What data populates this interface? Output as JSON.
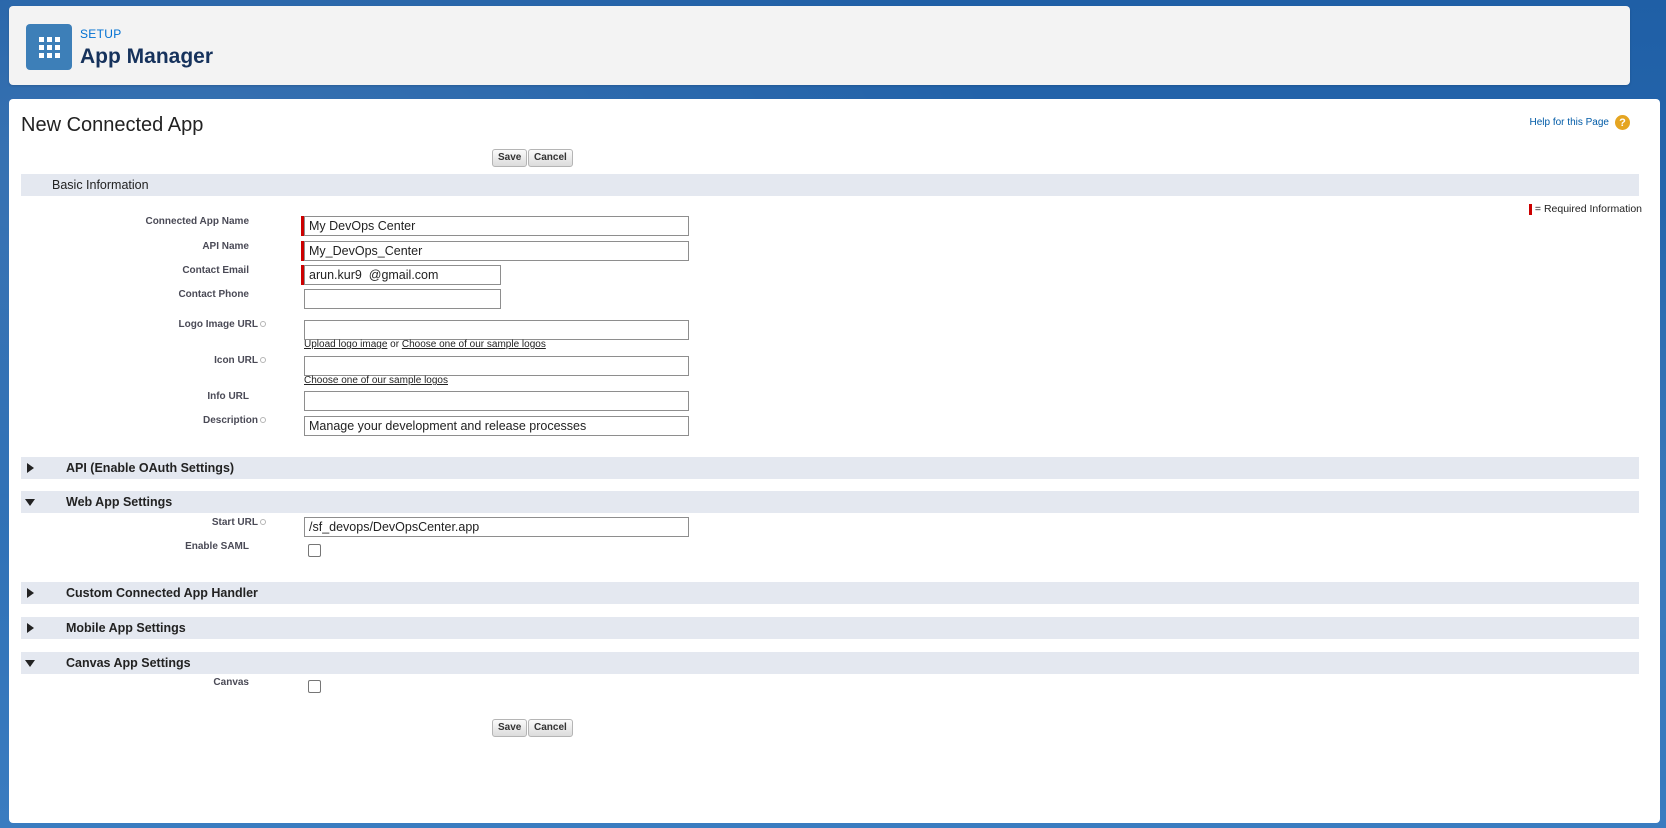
{
  "header": {
    "setup_label": "SETUP",
    "page_name": "App Manager",
    "icon": "app-launcher-grid-icon"
  },
  "page": {
    "title": "New Connected App",
    "help_link": "Help for this Page",
    "help_icon": "?"
  },
  "buttons": {
    "save": "Save",
    "cancel": "Cancel"
  },
  "required_info": "= Required Information",
  "sections": {
    "basic": "Basic Information",
    "api": "API (Enable OAuth Settings)",
    "web": "Web App Settings",
    "custom": "Custom Connected App Handler",
    "mobile": "Mobile App Settings",
    "canvas": "Canvas App Settings"
  },
  "fields": {
    "app_name": {
      "label": "Connected App Name",
      "value": "My DevOps Center"
    },
    "api_name": {
      "label": "API Name",
      "value": "My_DevOps_Center"
    },
    "contact_email": {
      "label": "Contact Email",
      "value": "arun.kur9  @gmail.com"
    },
    "contact_phone": {
      "label": "Contact Phone",
      "value": ""
    },
    "logo_url": {
      "label": "Logo Image URL",
      "value": ""
    },
    "icon_url": {
      "label": "Icon URL",
      "value": ""
    },
    "info_url": {
      "label": "Info URL",
      "value": ""
    },
    "description": {
      "label": "Description",
      "value": "Manage your development and release processes"
    },
    "start_url": {
      "label": "Start URL",
      "value": "/sf_devops/DevOpsCenter.app"
    },
    "enable_saml": {
      "label": "Enable SAML"
    },
    "canvas": {
      "label": "Canvas"
    }
  },
  "links": {
    "upload_logo": "Upload logo image",
    "or": " or ",
    "choose_logo": "Choose one of our sample logos",
    "choose_icon": "Choose one of our sample logos"
  },
  "colors": {
    "header_bg": "#f3f3f3",
    "section_bg": "#e4e8f0",
    "required": "#cc0000",
    "link": "#015ba7"
  }
}
